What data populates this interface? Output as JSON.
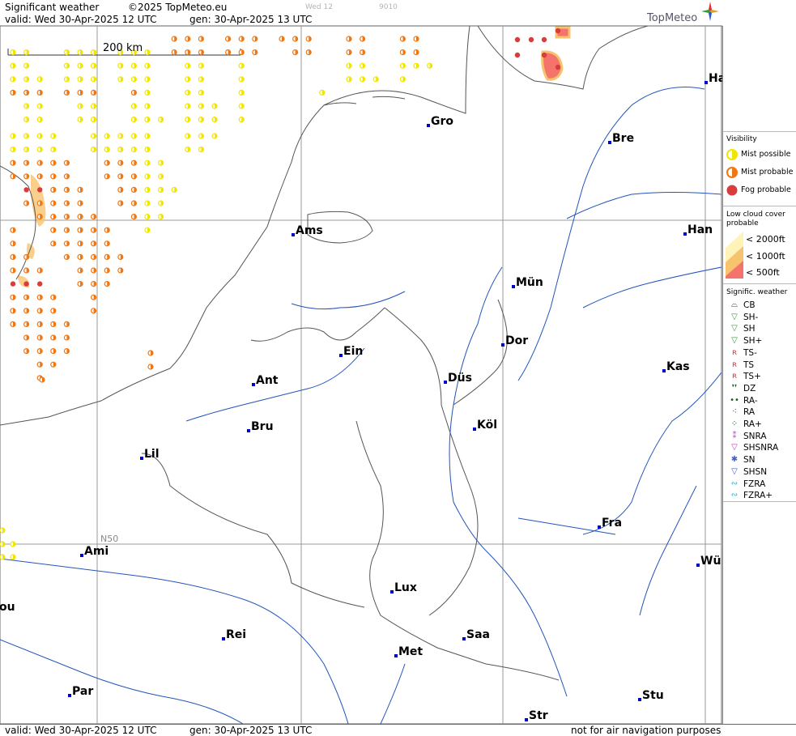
{
  "header": {
    "title": "Significant weather",
    "copyright": "©2025 TopMeteo.eu",
    "valid": "valid:  Wed  30-Apr-2025  12 UTC",
    "generated": "gen: 30-Apr-2025 13 UTC",
    "faint_day": "Wed 12",
    "faint_code": "9010",
    "brand": "TopMeteo"
  },
  "map": {
    "scale_label": "200 km",
    "lat_label": "N50",
    "cities": [
      {
        "name": "Ha"
      },
      {
        "name": "Gro"
      },
      {
        "name": "Bre"
      },
      {
        "name": "Ams"
      },
      {
        "name": "Han"
      },
      {
        "name": "Mün"
      },
      {
        "name": "Ein"
      },
      {
        "name": "Dor"
      },
      {
        "name": "Kas"
      },
      {
        "name": "Ant"
      },
      {
        "name": "Düs"
      },
      {
        "name": "Bru"
      },
      {
        "name": "Köl"
      },
      {
        "name": "Lil"
      },
      {
        "name": "Fra"
      },
      {
        "name": "Ami"
      },
      {
        "name": "Wü"
      },
      {
        "name": "Lux"
      },
      {
        "name": "ou"
      },
      {
        "name": "Rei"
      },
      {
        "name": "Saa"
      },
      {
        "name": "Met"
      },
      {
        "name": "Stu"
      },
      {
        "name": "Par"
      },
      {
        "name": "Str"
      }
    ]
  },
  "legend": {
    "visibility_title": "Visibility",
    "mist_possible": "Mist possible",
    "mist_probable": "Mist probable",
    "fog_probable": "Fog probable",
    "lowcloud_title": "Low cloud cover probable",
    "lc_2000": "< 2000ft",
    "lc_1000": "< 1000ft",
    "lc_500": "<   500ft",
    "sigwx_title": "Signific. weather",
    "items": [
      "CB",
      "SH-",
      "SH",
      "SH+",
      "TS-",
      "TS",
      "TS+",
      "DZ",
      "RA-",
      "RA",
      "RA+",
      "SNRA",
      "SHSNRA",
      "SN",
      "SHSN",
      "FZRA",
      "FZRA+"
    ],
    "colors": {
      "mist_possible": "#f2e600",
      "mist_probable": "#f07814",
      "fog": "#d83c3c",
      "lc_2000": "#fff3b8",
      "lc_1000": "#f7c36e",
      "lc_500": "#f4736a"
    }
  },
  "footer": {
    "valid": "valid:  Wed  30-Apr-2025  12 UTC",
    "generated": "gen: 30-Apr-2025 13 UTC",
    "disclaimer": "not for air navigation purposes"
  }
}
